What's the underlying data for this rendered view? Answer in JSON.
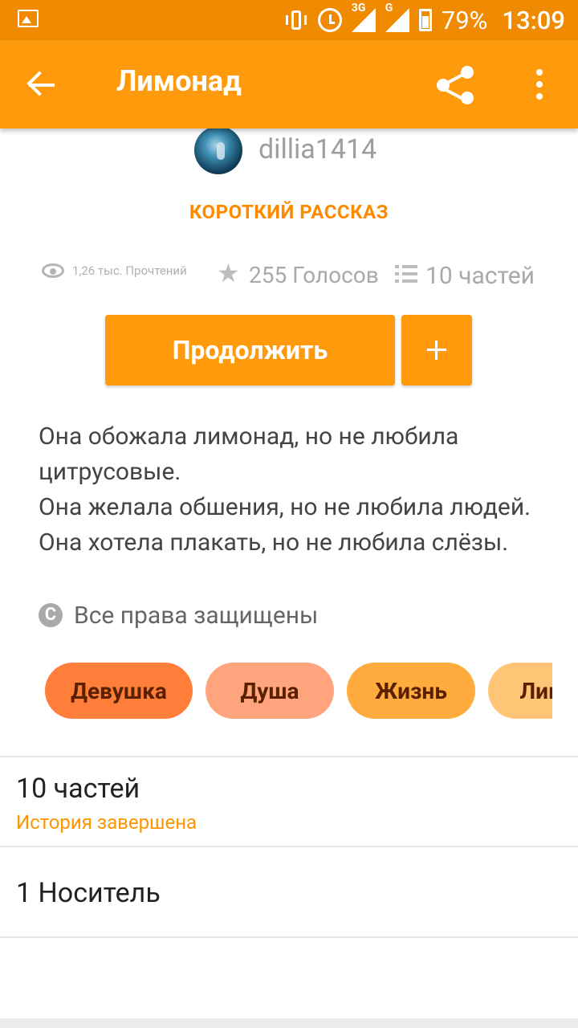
{
  "status_bar": {
    "battery": "79%",
    "time": "13:09",
    "network_3g": "3G",
    "network_g": "G",
    "icons": [
      "image-icon",
      "vibrate-icon",
      "alarm-icon",
      "signal-3g-icon",
      "signal-g-icon",
      "battery-icon"
    ]
  },
  "app_bar": {
    "title": "Лимонад",
    "icons": [
      "back-arrow-icon",
      "share-icon",
      "more-vert-icon"
    ],
    "color": "#ff9a0d"
  },
  "author": {
    "username": "dillia1414"
  },
  "story": {
    "category": "КОРОТКИЙ РАССКАЗ",
    "reads": "1,26 тыс. Прочтений",
    "votes": "255 Голосов",
    "parts": "10 частей",
    "description": [
      "Она обожала лимонад, но не любила",
      "цитрусовые.",
      "Она желала обшения, но не любила людей.",
      "Она хотела плакать, но не любила слёзы."
    ],
    "rights": "Все права защищены"
  },
  "actions": {
    "continue_label": "Продолжить",
    "add_label": "+"
  },
  "tags": [
    {
      "label": "Девушка",
      "color": "#ff7e3a"
    },
    {
      "label": "Душа",
      "color": "#ffa47c"
    },
    {
      "label": "Жизнь",
      "color": "#ffab3d"
    },
    {
      "label": "Лимонад",
      "color": "#ffc577"
    }
  ],
  "sections": {
    "parts_title": "10 частей",
    "parts_status": "История завершена",
    "carrier_title": "1 Носитель"
  },
  "colors": {
    "accent": "#ff9a0d",
    "accent_text": "#ff8a00"
  }
}
